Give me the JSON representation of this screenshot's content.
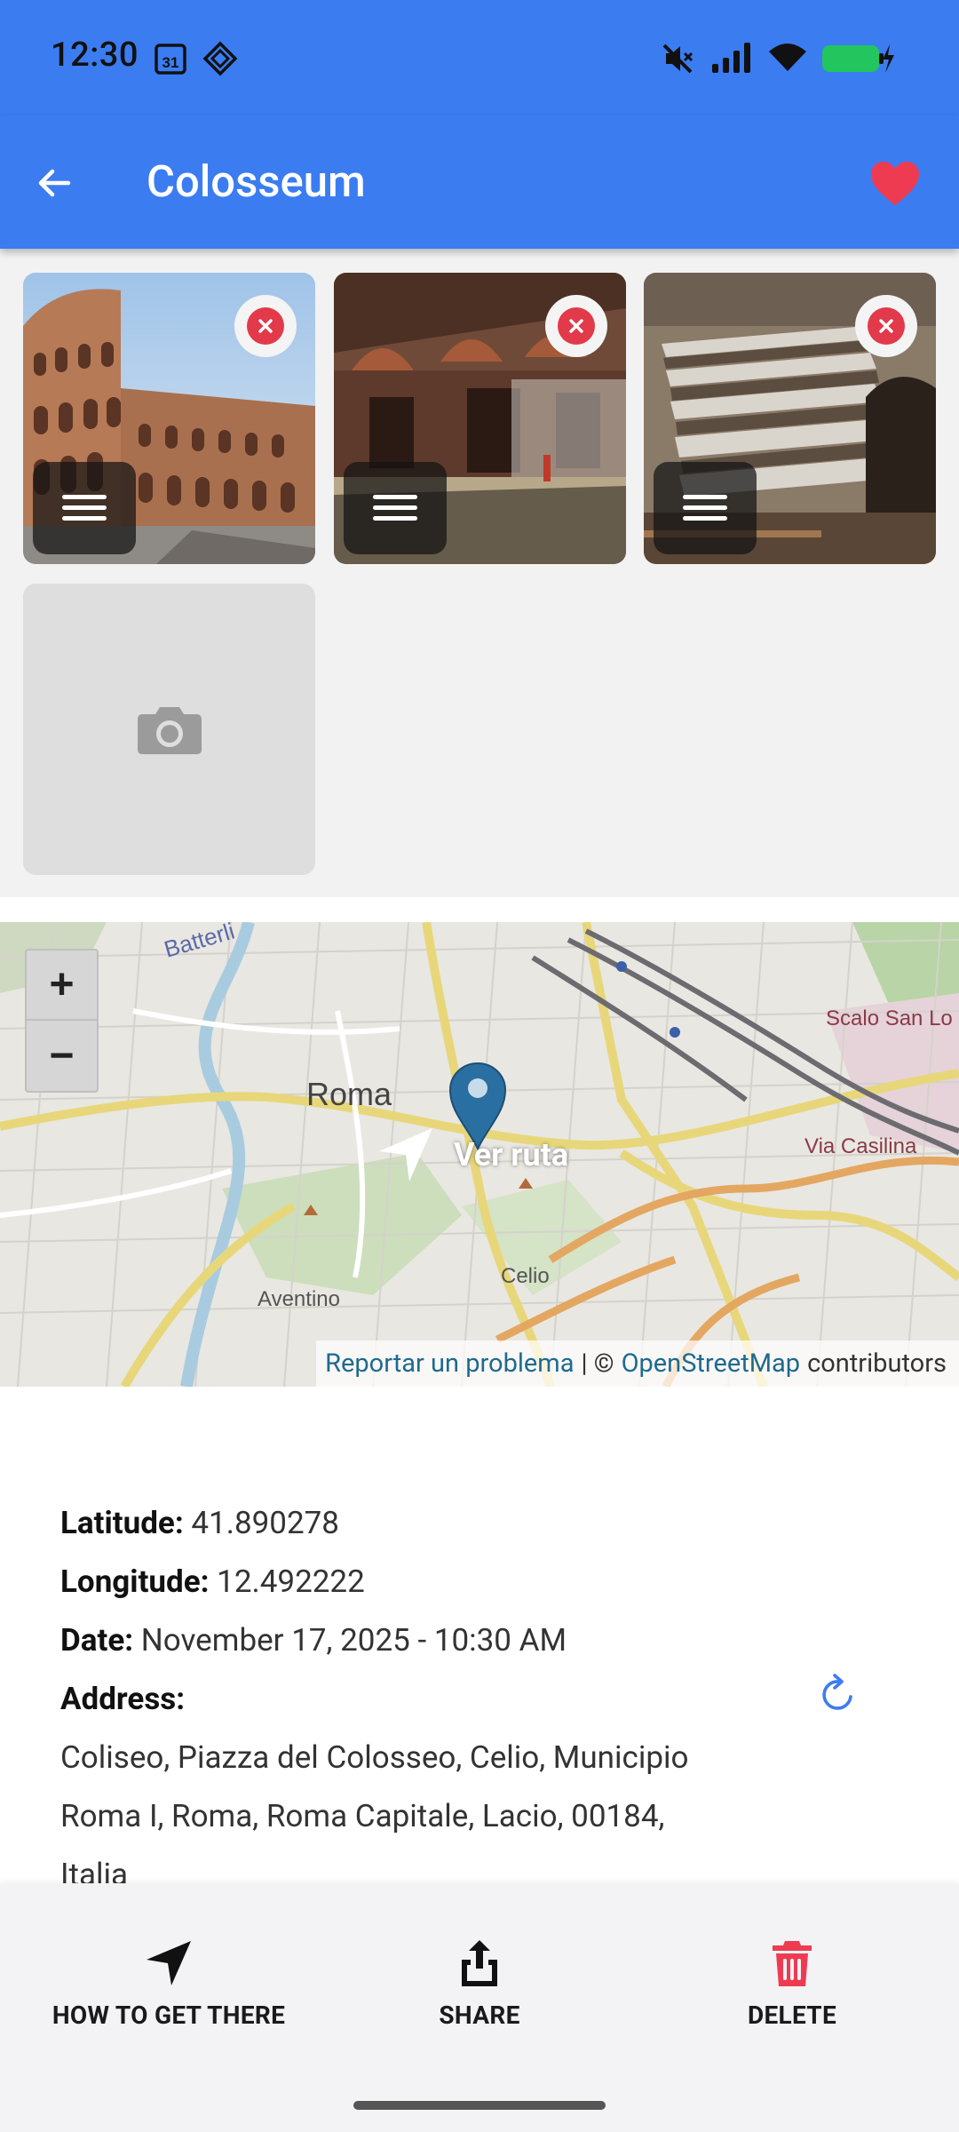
{
  "status_bar": {
    "time": "12:30",
    "calendar_day": "31",
    "battery_color": "#22c55e"
  },
  "app_bar": {
    "title": "Colosseum",
    "background": "#3b7cf1",
    "favorite_color": "#ef3b52"
  },
  "photos": {
    "items": [
      {
        "subject": "colosseum-exterior"
      },
      {
        "subject": "colosseum-interior-arches"
      },
      {
        "subject": "colosseum-seating-tiers"
      }
    ],
    "remove_color": "#e23a4a",
    "add_icon": "camera-icon"
  },
  "map": {
    "labels": {
      "roma": "Roma",
      "celio": "Celio",
      "aventino": "Aventino",
      "scolo": "Scalo San Lo",
      "via_casilina": "Via Casilina",
      "batterli": "Batterli"
    },
    "zoom_in": "+",
    "zoom_out": "−",
    "route_label": "Ver ruta",
    "attribution": {
      "report": "Reportar un problema",
      "separator": "| ©",
      "osm": "OpenStreetMap",
      "contributors": "contributors"
    }
  },
  "details": {
    "latitude_label": "Latitude:",
    "latitude": "41.890278",
    "longitude_label": "Longitude:",
    "longitude": "12.492222",
    "date_label": "Date:",
    "date": "November 17, 2025 - 10:30 AM",
    "address_label": "Address:",
    "address": "Coliseo, Piazza del Colosseo, Celio, Municipio Roma I, Roma, Roma Capitale, Lacio, 00184, Italia"
  },
  "bottom_bar": {
    "directions_label": "HOW TO GET THERE",
    "share_label": "SHARE",
    "delete_label": "DELETE",
    "delete_color": "#ef3b52"
  }
}
